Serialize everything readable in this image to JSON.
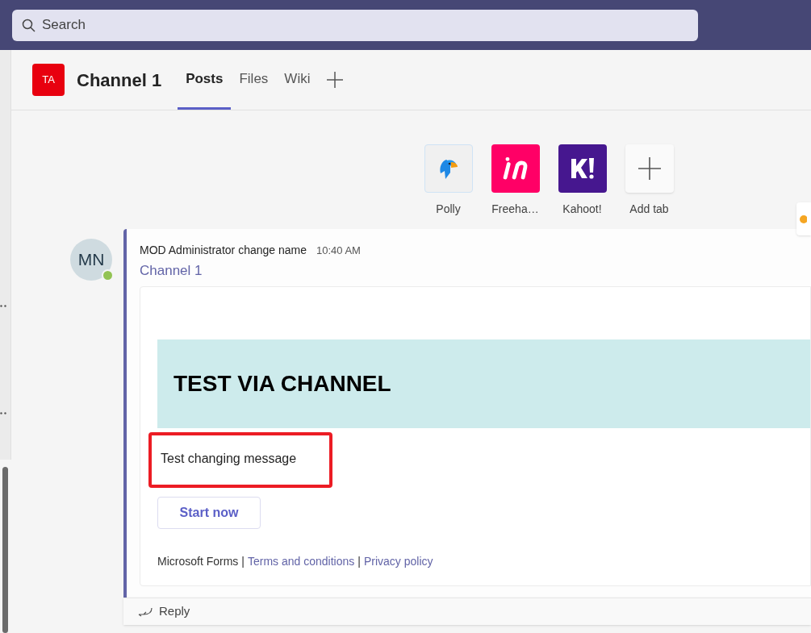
{
  "search": {
    "placeholder": "Search"
  },
  "channel": {
    "team_avatar": "TA",
    "title": "Channel 1"
  },
  "tabs": [
    {
      "label": "Posts",
      "selected": true
    },
    {
      "label": "Files",
      "selected": false
    },
    {
      "label": "Wiki",
      "selected": false
    }
  ],
  "apps": [
    {
      "label": "Polly",
      "kind": "polly"
    },
    {
      "label": "Freeha…",
      "kind": "invision"
    },
    {
      "label": "Kahoot!",
      "kind": "kahoot"
    },
    {
      "label": "Add tab",
      "kind": "add"
    }
  ],
  "message": {
    "avatar": "MN",
    "online": true,
    "author": "MOD Administrator change name",
    "time": "10:40 AM",
    "channel_link": "Channel 1",
    "card": {
      "title": "TEST VIA CHANNEL",
      "body": "Test changing message",
      "body_highlighted": true,
      "button": "Start now",
      "footer": [
        {
          "text": "Microsoft Forms",
          "kind": "text"
        },
        {
          "text": "|",
          "kind": "text"
        },
        {
          "text": "Terms and conditions",
          "kind": "link"
        },
        {
          "text": "|",
          "kind": "text"
        },
        {
          "text": "Privacy policy",
          "kind": "link"
        }
      ]
    },
    "reply": "Reply"
  }
}
